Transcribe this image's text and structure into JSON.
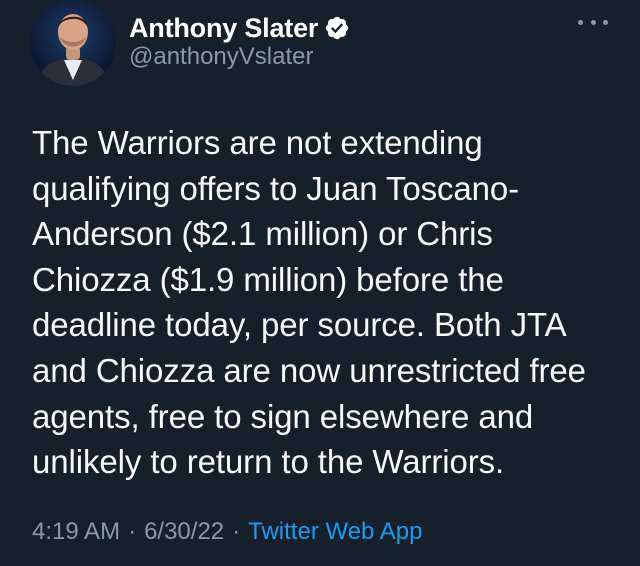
{
  "author": {
    "display_name": "Anthony Slater",
    "handle": "@anthonyVslater",
    "verified": true
  },
  "tweet": {
    "text": "The Warriors are not extending\nqualifying offers to Juan Toscano-\nAnderson ($2.1 million) or Chris\nChiozza ($1.9 million) before the\ndeadline today, per source. Both JTA\nand Chiozza are now unrestricted free\nagents, free to sign elsewhere and\nunlikely to return to the Warriors.",
    "time": "4:19 AM",
    "date": "6/30/22",
    "separator": "·",
    "source": "Twitter Web App"
  },
  "icons": {
    "verified": "verified-badge-icon",
    "more": "more-options-icon"
  },
  "colors": {
    "background": "#15202b",
    "text": "#f7f9f9",
    "secondary": "#8b98a5",
    "accent": "#1d9bf0"
  }
}
